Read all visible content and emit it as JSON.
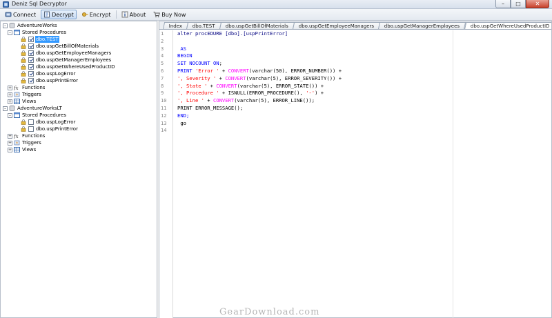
{
  "window": {
    "title": "Deniz Sql Decryptor"
  },
  "toolbar": {
    "items": [
      {
        "label": "Connect",
        "icon": "connect-icon"
      },
      {
        "label": "Decrypt",
        "icon": "decrypt-icon",
        "active": true
      },
      {
        "label": "Encrypt",
        "icon": "encrypt-icon"
      },
      {
        "label": "About",
        "icon": "about-icon"
      },
      {
        "label": "Buy Now",
        "icon": "cart-icon"
      }
    ]
  },
  "tree": {
    "db1": {
      "name": "AdventureWorks",
      "stored_procedures": "Stored Procedures",
      "procs": [
        "dbo.TEST",
        "dbo.uspGetBillOfMaterials",
        "dbo.uspGetEmployeeManagers",
        "dbo.uspGetManagerEmployees",
        "dbo.uspGetWhereUsedProductID",
        "dbo.uspLogError",
        "dbo.uspPrintError"
      ],
      "functions": "Functions",
      "triggers": "Triggers",
      "views": "Views"
    },
    "db2": {
      "name": "AdventureWorksLT",
      "stored_procedures": "Stored Procedures",
      "procs": [
        "dbo.uspLogError",
        "dbo.uspPrintError"
      ],
      "functions": "Functions",
      "triggers": "Triggers",
      "views": "Views"
    }
  },
  "editor": {
    "tabs": [
      "Index",
      "dbo.TEST",
      "dbo.uspGetBillOfMaterials",
      "dbo.uspGetEmployeeManagers",
      "dbo.uspGetManagerEmployees",
      "dbo.uspGetWhereUsedProductID"
    ],
    "line_numbers": [
      "1",
      "2",
      "3",
      "4",
      "5",
      "6",
      "7",
      "8",
      "9",
      "10",
      "11",
      "12",
      "13",
      "14"
    ],
    "code": {
      "l1": "alter procEDURE [dbo].[uspPrintError]",
      "l3": " AS",
      "l4": "BEGIN",
      "l5a": "SET NOCOUNT ",
      "l5b": "ON",
      "l5c": ";",
      "l6a": "PRINT ",
      "l6b": "'Error '",
      "l6c": " + ",
      "l6d": "CONVERT",
      "l6e": "(varchar(50), ERROR_NUMBER()) +",
      "l7a": "', Severity '",
      "l7b": " + ",
      "l7c": "CONVERT",
      "l7d": "(varchar(5), ERROR_SEVERITY()) +",
      "l8a": "', State '",
      "l8b": " + ",
      "l8c": "CONVERT",
      "l8d": "(varchar(5), ERROR_STATE()) +",
      "l9a": "', Procedure '",
      "l9b": " + ISNULL(ERROR_PROCEDURE(), ",
      "l9c": "'-'",
      "l9d": ") +",
      "l10a": "', Line '",
      "l10b": " + ",
      "l10c": "CONVERT",
      "l10d": "(varchar(5), ERROR_LINE());",
      "l11": "PRINT ERROR_MESSAGE();",
      "l12": "END;",
      "l13": " go"
    }
  },
  "watermark": "GearDownload.com"
}
